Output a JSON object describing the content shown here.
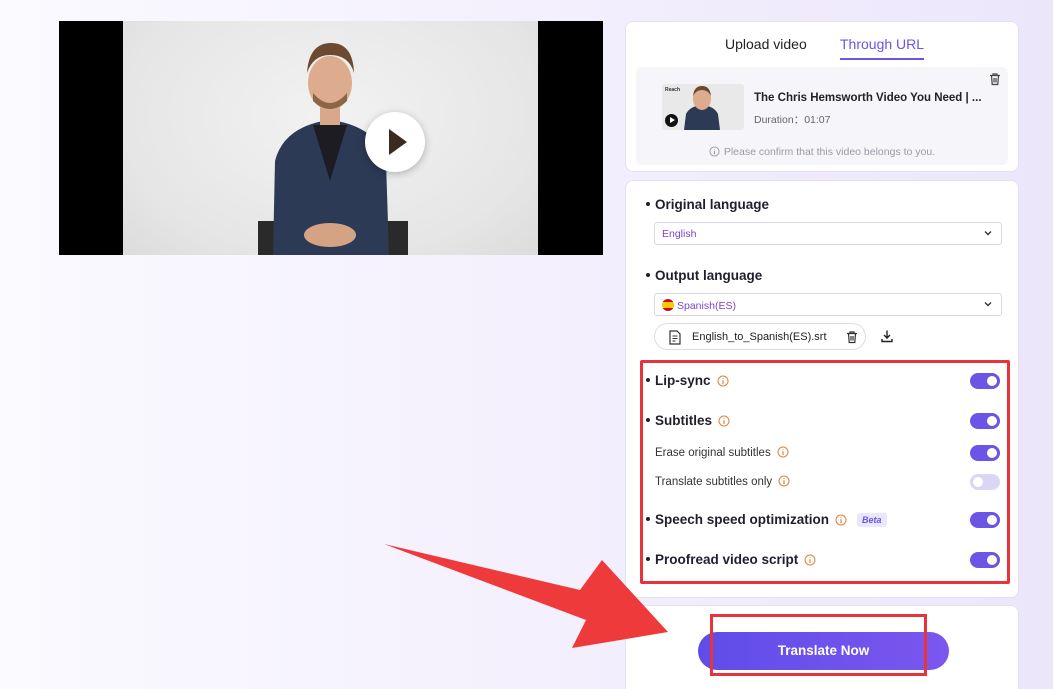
{
  "tabs": {
    "upload": "Upload video",
    "url": "Through URL"
  },
  "video": {
    "title": "The Chris Hemsworth Video You Need | ...",
    "duration": "Duration：01:07",
    "confirm_text": "Please confirm that this video belongs to you.",
    "thumb_tag": "Reach"
  },
  "original_language": {
    "label": "Original language",
    "value": "English"
  },
  "output_language": {
    "label": "Output language",
    "value": "Spanish(ES)",
    "file": "English_to_Spanish(ES).srt"
  },
  "options": [
    {
      "label": "Lip-sync",
      "enabled": true
    },
    {
      "label": "Subtitles",
      "enabled": true
    },
    {
      "label": "Erase original subtitles",
      "enabled": true
    },
    {
      "label": "Translate subtitles only",
      "enabled": false
    },
    {
      "label": "Speech speed optimization",
      "badge": "Beta",
      "enabled": true
    },
    {
      "label": "Proofread video script",
      "enabled": true
    }
  ],
  "translate_button": "Translate Now",
  "colors": {
    "accent": "#6b55e5",
    "highlight": "#e8333a",
    "info": "#e0823a"
  }
}
